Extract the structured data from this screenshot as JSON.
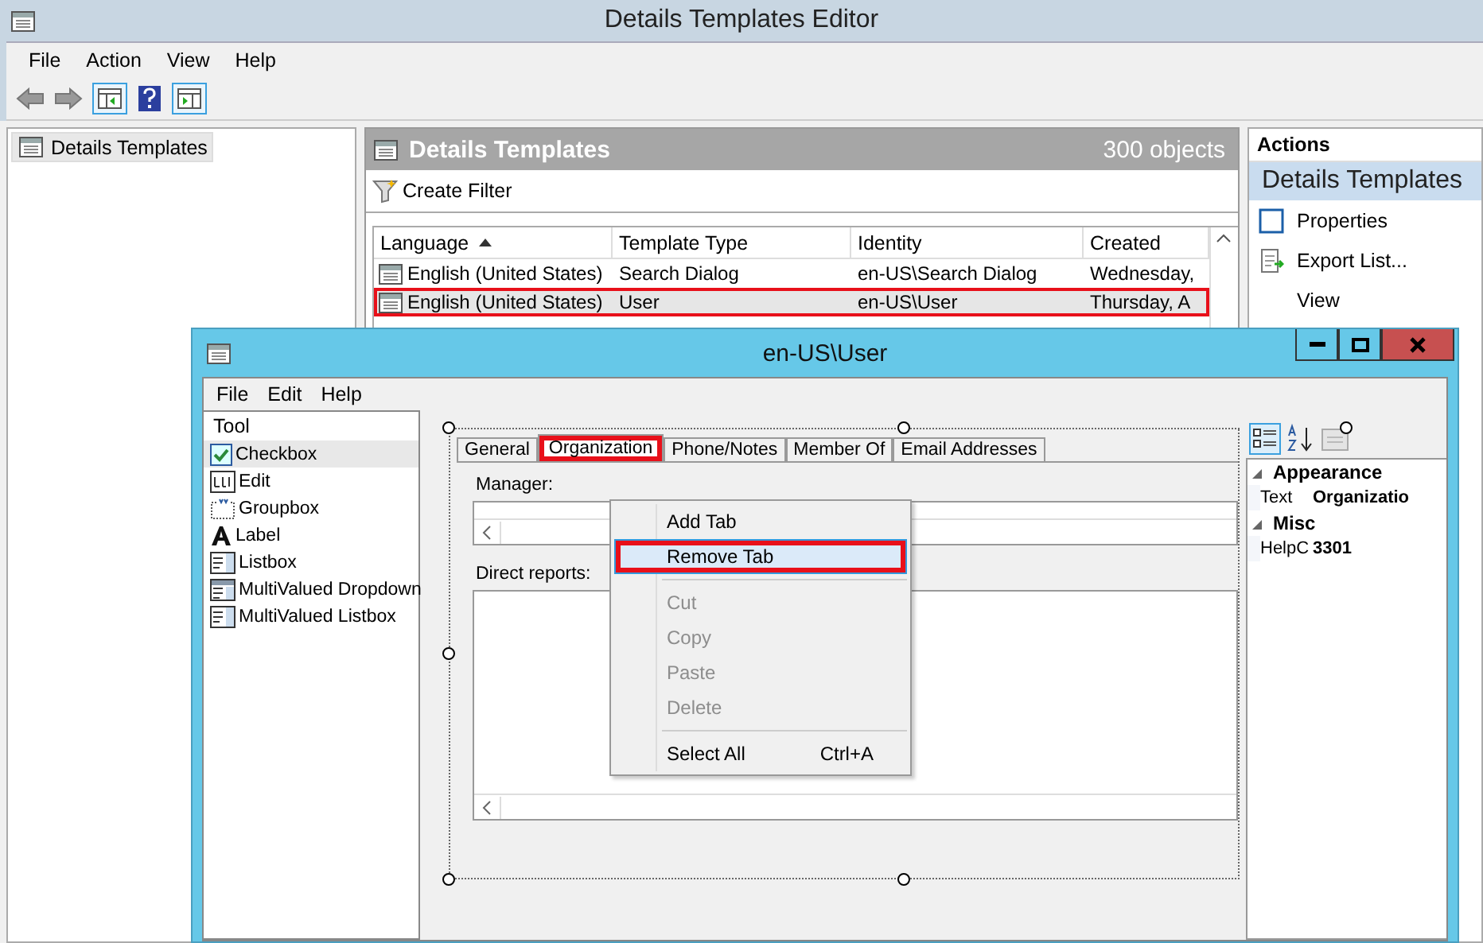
{
  "main_window": {
    "title": "Details Templates Editor",
    "menu": [
      "File",
      "Action",
      "View",
      "Help"
    ],
    "tree": [
      {
        "label": "Details Templates",
        "selected": true
      }
    ],
    "list_panel": {
      "title": "Details Templates",
      "count": "300 objects",
      "filter_button": "Create Filter",
      "columns": [
        {
          "label": "Language",
          "sorted": true
        },
        {
          "label": "Template Type",
          "sorted": false
        },
        {
          "label": "Identity",
          "sorted": false
        },
        {
          "label": "Created",
          "sorted": false
        }
      ],
      "rows": [
        {
          "cells": [
            "English (United States)",
            "Search Dialog",
            "en-US\\Search Dialog",
            "Wednesday,"
          ],
          "selected": false,
          "highlighted": false
        },
        {
          "cells": [
            "English (United States)",
            "User",
            "en-US\\User",
            "Thursday, A"
          ],
          "selected": true,
          "highlighted": true
        }
      ]
    },
    "actions": {
      "title": "Actions",
      "section": "Details Templates",
      "items": [
        {
          "label": "Properties",
          "kind": "properties"
        },
        {
          "label": "Export List...",
          "kind": "export"
        },
        {
          "label": "View",
          "kind": "plain"
        }
      ]
    }
  },
  "dialog": {
    "title": "en-US\\User",
    "menu": [
      "File",
      "Edit",
      "Help"
    ],
    "toolbox": {
      "title": "Tool",
      "items": [
        {
          "label": "Checkbox",
          "kind": "checkbox",
          "selected": true
        },
        {
          "label": "Edit",
          "kind": "edit",
          "selected": false
        },
        {
          "label": "Groupbox",
          "kind": "groupbox",
          "selected": false
        },
        {
          "label": "Label",
          "kind": "label",
          "selected": false
        },
        {
          "label": "Listbox",
          "kind": "listbox",
          "selected": false
        },
        {
          "label": "MultiValued Dropdown",
          "kind": "dropdown",
          "selected": false
        },
        {
          "label": "MultiValued Listbox",
          "kind": "listbox",
          "selected": false
        }
      ]
    },
    "tabs": [
      {
        "label": "General",
        "selected": false,
        "highlighted": false
      },
      {
        "label": "Organization",
        "selected": true,
        "highlighted": true
      },
      {
        "label": "Phone/Notes",
        "selected": false,
        "highlighted": false
      },
      {
        "label": "Member Of",
        "selected": false,
        "highlighted": false
      },
      {
        "label": "Email Addresses",
        "selected": false,
        "highlighted": false
      }
    ],
    "fields": [
      {
        "label": "Manager:",
        "kind": "single"
      },
      {
        "label": "Direct reports:",
        "kind": "list"
      }
    ],
    "properties": [
      {
        "category": "Appearance",
        "expanded": true,
        "rows": [
          {
            "name": "Text",
            "value": "Organizatio"
          }
        ]
      },
      {
        "category": "Misc",
        "expanded": true,
        "rows": [
          {
            "name": "HelpC",
            "value": "3301"
          }
        ]
      }
    ],
    "context_menu": [
      {
        "kind": "item",
        "label": "Add Tab",
        "disabled": false,
        "hovered": false,
        "highlighted": false
      },
      {
        "kind": "item",
        "label": "Remove Tab",
        "disabled": false,
        "hovered": true,
        "highlighted": true
      },
      {
        "kind": "separator"
      },
      {
        "kind": "item",
        "label": "Cut",
        "disabled": true,
        "hovered": false,
        "highlighted": false
      },
      {
        "kind": "item",
        "label": "Copy",
        "disabled": true,
        "hovered": false,
        "highlighted": false
      },
      {
        "kind": "item",
        "label": "Paste",
        "disabled": true,
        "hovered": false,
        "highlighted": false
      },
      {
        "kind": "item",
        "label": "Delete",
        "disabled": true,
        "hovered": false,
        "highlighted": false
      },
      {
        "kind": "separator"
      },
      {
        "kind": "item",
        "label": "Select All",
        "shortcut": "Ctrl+A",
        "disabled": false,
        "hovered": false,
        "highlighted": false
      }
    ]
  }
}
